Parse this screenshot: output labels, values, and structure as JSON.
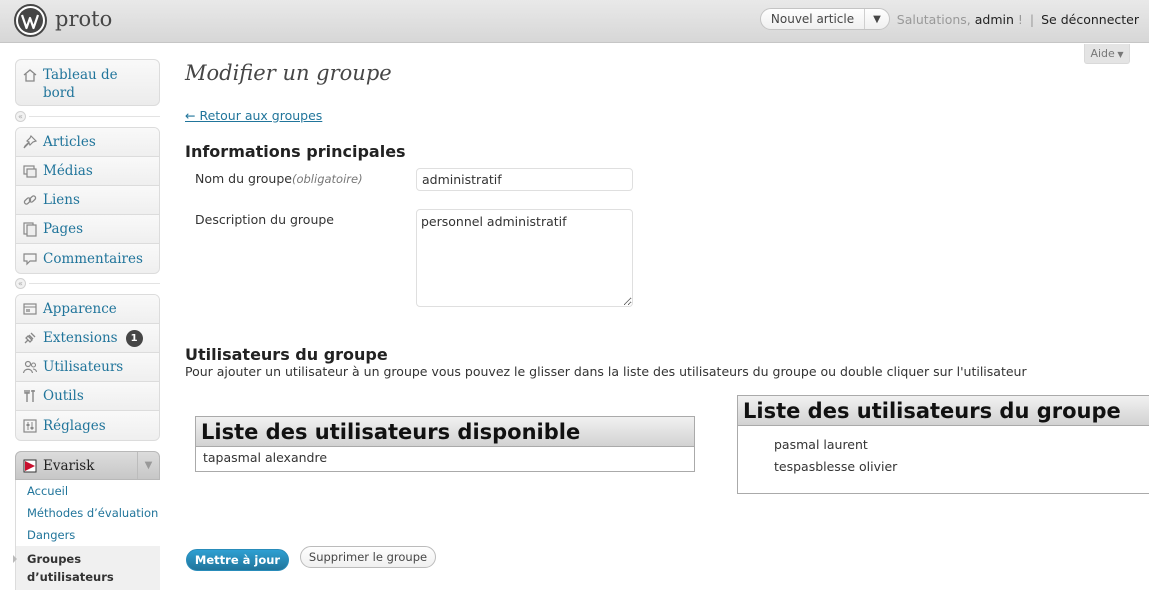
{
  "header": {
    "site_title": "proto",
    "new_post_label": "Nouvel article",
    "greeting": "Salutations,",
    "username": "admin",
    "greeting_suffix": "!",
    "separator": "|",
    "logout_label": "Se déconnecter",
    "help_label": "Aide"
  },
  "sidebar": {
    "dashboard": "Tableau de bord",
    "group1": [
      {
        "label": "Articles",
        "icon": "pin-icon"
      },
      {
        "label": "Médias",
        "icon": "media-icon"
      },
      {
        "label": "Liens",
        "icon": "link-icon"
      },
      {
        "label": "Pages",
        "icon": "pages-icon"
      },
      {
        "label": "Commentaires",
        "icon": "comment-icon"
      }
    ],
    "group2": [
      {
        "label": "Apparence",
        "icon": "appearance-icon"
      },
      {
        "label": "Extensions",
        "icon": "plugin-icon",
        "badge": "1"
      },
      {
        "label": "Utilisateurs",
        "icon": "users-icon"
      },
      {
        "label": "Outils",
        "icon": "tools-icon"
      },
      {
        "label": "Réglages",
        "icon": "settings-icon"
      }
    ],
    "evarisk": {
      "label": "Evarisk",
      "items": [
        "Accueil",
        "Méthodes d’évaluation",
        "Dangers"
      ],
      "current": "Groupes\nd’utilisateurs"
    }
  },
  "main": {
    "title": "Modifier un groupe",
    "back_link": "← Retour aux groupes",
    "section_main": "Informations principales",
    "name_label": "Nom du groupe",
    "name_required": "(obligatoire)",
    "name_value": "administratif",
    "desc_label": "Description du groupe",
    "desc_value": "personnel administratif",
    "section_users": "Utilisateurs du groupe",
    "users_help": "Pour ajouter un utilisateur à un groupe vous pouvez le glisser dans la liste des utilisateurs du groupe ou double cliquer sur l'utilisateur",
    "available_list": {
      "title": "Liste des utilisateurs disponible",
      "users": [
        "tapasmal alexandre"
      ]
    },
    "group_list": {
      "title": "Liste des utilisateurs du groupe",
      "users": [
        "pasmal laurent",
        "tespasblesse olivier"
      ]
    },
    "update_button": "Mettre à jour",
    "delete_button": "Supprimer le groupe"
  },
  "colors": {
    "link": "#21759b",
    "primary_button": "#21759b",
    "badge": "#464646"
  }
}
